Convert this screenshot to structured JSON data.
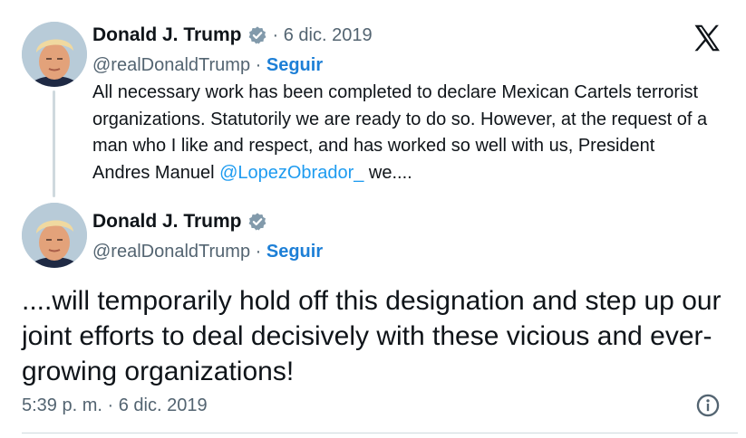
{
  "tweets": [
    {
      "author_name": "Donald J. Trump",
      "handle": "@realDonaldTrump",
      "separator": "·",
      "date": "6 dic. 2019",
      "follow_label": "Seguir",
      "text_before_mention": "All necessary work has been completed to declare Mexican Cartels terrorist organizations. Statutorily we are ready to do so. However, at the request of a man who I like and respect, and has worked so well with us, President Andres Manuel ",
      "mention": "@LopezObrador_",
      "text_after_mention": " we...."
    },
    {
      "author_name": "Donald J. Trump",
      "handle": "@realDonaldTrump",
      "separator": "·",
      "follow_label": "Seguir",
      "text": "....will temporarily hold off this designation and step up our joint efforts to deal decisively with these vicious and ever-growing organizations!"
    }
  ],
  "timestamp": "5:39 p. m. · 6 dic. 2019",
  "icons": {
    "platform": "x-logo-icon",
    "verified": "verified-badge-icon",
    "info": "info-icon"
  },
  "colors": {
    "text": "#0f1419",
    "secondary": "#536471",
    "link": "#1d9bf0",
    "follow": "#1d7fd6",
    "verified": "#829aab"
  }
}
